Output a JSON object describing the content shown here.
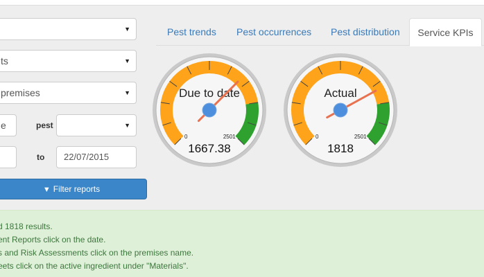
{
  "filters": {
    "select1_value": "",
    "select2_value": "ts",
    "select3_value": "premises",
    "input1_value": "e",
    "pest_label": "pest",
    "pest_value": "",
    "date_from_value": "",
    "to_label": "to",
    "date_to_value": "22/07/2015",
    "filter_button_label": "Filter reports"
  },
  "tabs": [
    {
      "label": "Pest trends",
      "active": false
    },
    {
      "label": "Pest occurrences",
      "active": false
    },
    {
      "label": "Pest distribution",
      "active": false
    },
    {
      "label": "Service KPIs",
      "active": true
    }
  ],
  "gauges": [
    {
      "title": "Due to date",
      "value_label": "1667.38",
      "value": 1667.38,
      "min_label": "0",
      "max_label": "2501",
      "min": 0,
      "max": 2501
    },
    {
      "title": "Actual",
      "value_label": "1818",
      "value": 1818,
      "min_label": "0",
      "max_label": "2501",
      "min": 0,
      "max": 2501
    }
  ],
  "gauge_colors": {
    "track": "#ffa31a",
    "high": "#2ea12e",
    "needle": "#e8724f",
    "hub": "#4d8fdd"
  },
  "info": {
    "line1": "d 1818 results.",
    "line2": "ent Reports click on the date.",
    "line3": "s and Risk Assessments click on the premises name.",
    "line4": "eets click on the active ingredient under \"Materials\"."
  }
}
